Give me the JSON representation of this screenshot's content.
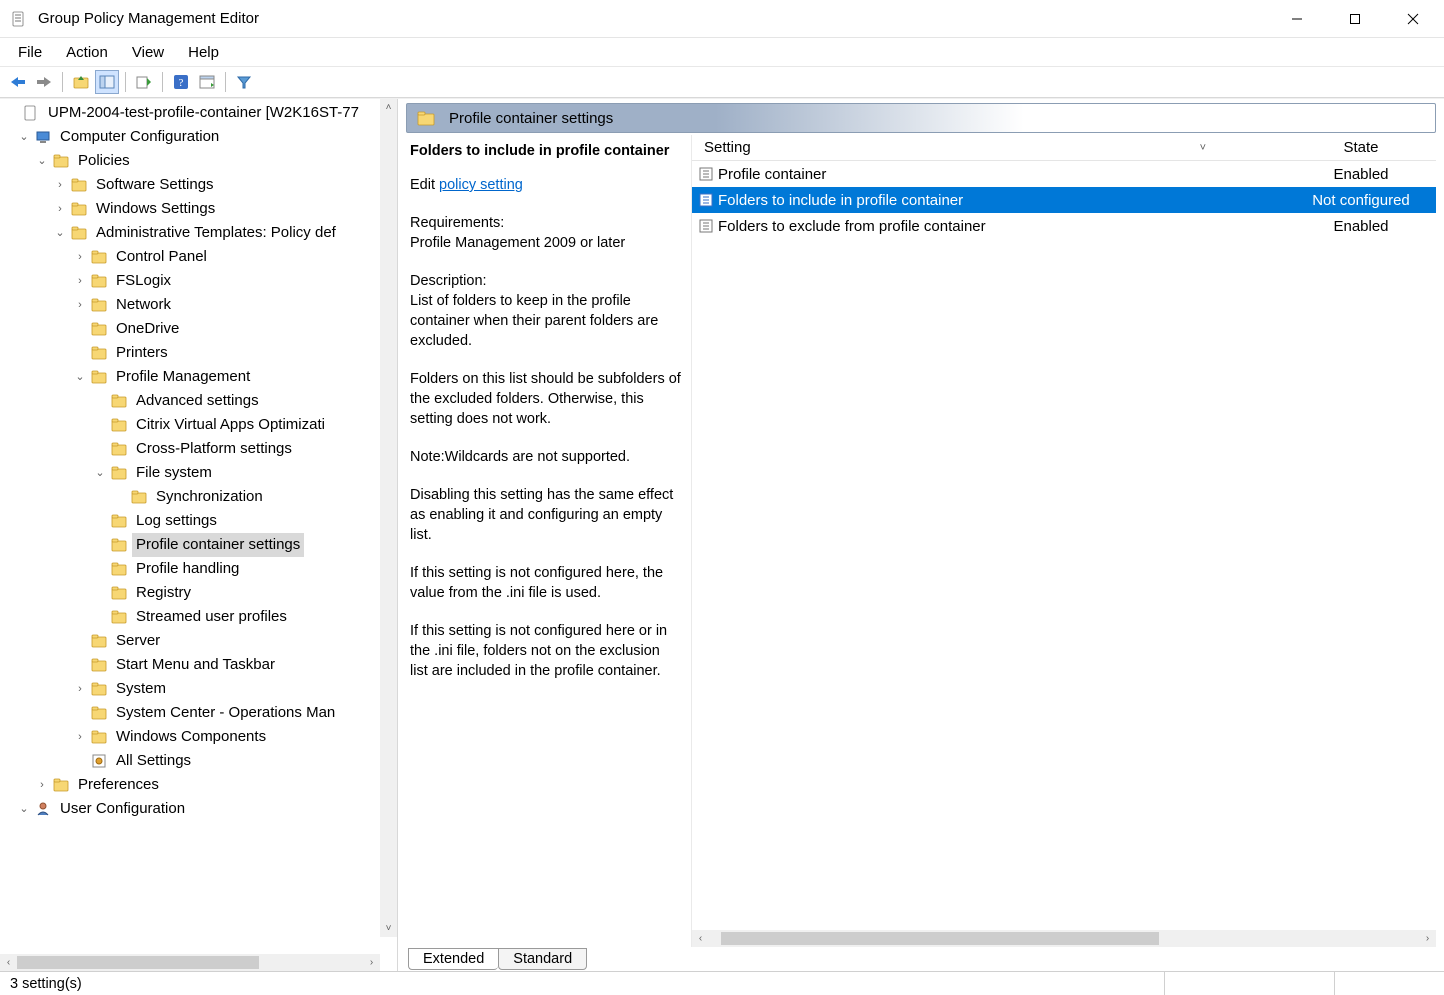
{
  "window": {
    "title": "Group Policy Management Editor"
  },
  "menu": {
    "items": [
      "File",
      "Action",
      "View",
      "Help"
    ]
  },
  "toolbar": {
    "back": "back-arrow",
    "forward": "forward-arrow",
    "up": "folder-up",
    "props": "properties",
    "export": "export-list",
    "help": "help",
    "refresh": "refresh-panel",
    "filter": "filter"
  },
  "tree": {
    "root": "UPM-2004-test-profile-container [W2K16ST-77",
    "computer_config": "Computer Configuration",
    "policies": "Policies",
    "software_settings": "Software Settings",
    "windows_settings": "Windows Settings",
    "admin_templates": "Administrative Templates: Policy def",
    "control_panel": "Control Panel",
    "fslogix": "FSLogix",
    "network": "Network",
    "onedrive": "OneDrive",
    "printers": "Printers",
    "profile_mgmt": "Profile Management",
    "advanced": "Advanced settings",
    "citrix_opt": "Citrix Virtual Apps Optimizati",
    "cross_platform": "Cross-Platform settings",
    "file_system": "File system",
    "synchronization": "Synchronization",
    "log_settings": "Log settings",
    "profile_container": "Profile container settings",
    "profile_handling": "Profile handling",
    "registry": "Registry",
    "streamed": "Streamed user profiles",
    "server": "Server",
    "start_menu": "Start Menu and Taskbar",
    "system": "System",
    "sccm": "System Center - Operations Man",
    "win_comp": "Windows Components",
    "all_settings": "All Settings",
    "preferences": "Preferences",
    "user_config": "User Configuration"
  },
  "detail": {
    "path_header": "Profile container settings",
    "heading": "Folders to include in profile container",
    "edit_label": "Edit ",
    "edit_link": "policy setting ",
    "req_label": "Requirements:",
    "req_text": "Profile Management 2009 or later",
    "desc_label": "Description:",
    "desc_p1": "List of folders to keep in the profile container when their parent folders are excluded.",
    "desc_p2": "Folders on this list should be subfolders of the excluded folders. Otherwise, this setting does not work.",
    "desc_p3": "Note:Wildcards are not supported.",
    "desc_p4": "Disabling this setting has the same effect as enabling it and configuring an empty list.",
    "desc_p5": "If this setting is not configured here, the value from the .ini file is used.",
    "desc_p6": "If this setting is not configured here or in the .ini file, folders not on the exclusion list are included in the profile container.",
    "columns": {
      "setting": "Setting",
      "state": "State"
    },
    "rows": [
      {
        "setting": "Profile container",
        "state": "Enabled",
        "selected": false
      },
      {
        "setting": "Folders to include in profile container",
        "state": "Not configured",
        "selected": true
      },
      {
        "setting": "Folders to exclude from profile container",
        "state": "Enabled",
        "selected": false
      }
    ],
    "tabs": {
      "extended": "Extended",
      "standard": "Standard"
    }
  },
  "status": {
    "text": "3 setting(s)"
  }
}
